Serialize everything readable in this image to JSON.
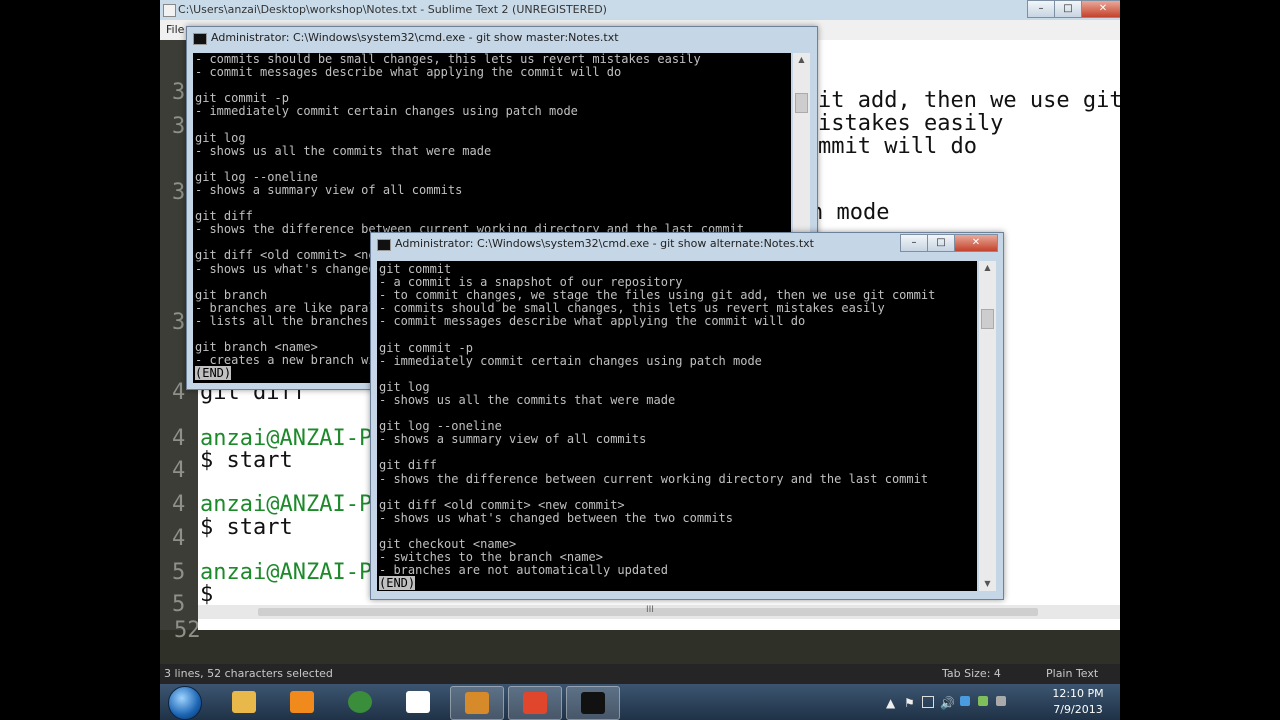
{
  "sublime": {
    "title": "C:\\Users\\anzai\\Desktop\\workshop\\Notes.txt - Sublime Text 2 (UNREGISTERED)",
    "menu_file": "File",
    "line_numbers": [
      "3",
      "3",
      "3",
      "3",
      "4",
      "4",
      "4",
      "4",
      "4",
      "5",
      "5",
      "52"
    ],
    "right_lines": [
      "it add, then we use git",
      "istakes easily",
      "mmit will do",
      "h mode"
    ],
    "left_lines": [
      {
        "text": "git diff",
        "green": false
      },
      {
        "text": "anzai@ANZAI-P",
        "green": true
      },
      {
        "text": "$ start",
        "green": false
      },
      {
        "text": "anzai@ANZAI-P",
        "green": true
      },
      {
        "text": "$ start",
        "green": false
      },
      {
        "text": "anzai@ANZAI-P",
        "green": true
      },
      {
        "text": "$",
        "green": false
      }
    ],
    "status_left": "3 lines, 52 characters selected",
    "status_tab": "Tab Size: 4",
    "status_syntax": "Plain Text",
    "scroll_marker": "III"
  },
  "cmd_back": {
    "title": "Administrator: C:\\Windows\\system32\\cmd.exe - git  show master:Notes.txt",
    "lines": [
      "- commits should be small changes, this lets us revert mistakes easily",
      "- commit messages describe what applying the commit will do",
      "",
      "git commit -p",
      "- immediately commit certain changes using patch mode",
      "",
      "git log",
      "- shows us all the commits that were made",
      "",
      "git log --oneline",
      "- shows a summary view of all commits",
      "",
      "git diff",
      "- shows the difference between current working directory and the last commit",
      "",
      "git diff <old commit> <new commit>",
      "- shows us what's changed between the two commits",
      "",
      "git branch",
      "- branches are like parallel universes",
      "- lists all the branches",
      "",
      "git branch <name>",
      "- creates a new branch with the specified name"
    ],
    "end": "(END)"
  },
  "cmd_front": {
    "title": "Administrator: C:\\Windows\\system32\\cmd.exe - git  show alternate:Notes.txt",
    "lines": [
      "git commit",
      "- a commit is a snapshot of our repository",
      "- to commit changes, we stage the files using git add, then we use git commit",
      "- commits should be small changes, this lets us revert mistakes easily",
      "- commit messages describe what applying the commit will do",
      "",
      "git commit -p",
      "- immediately commit certain changes using patch mode",
      "",
      "git log",
      "- shows us all the commits that were made",
      "",
      "git log --oneline",
      "- shows a summary view of all commits",
      "",
      "git diff",
      "- shows the difference between current working directory and the last commit",
      "",
      "git diff <old commit> <new commit>",
      "- shows us what's changed between the two commits",
      "",
      "git checkout <name>",
      "- switches to the branch <name>",
      "- branches are not automatically updated"
    ],
    "end": "(END)"
  },
  "window_buttons": {
    "minimize": "–",
    "maximize": "□",
    "close": "✕"
  },
  "taskbar": {
    "time": "12:10 PM",
    "date": "7/9/2013",
    "tray_arrow": "▲",
    "tray_flag": "⚑",
    "tray_volume": "🔊",
    "items": [
      {
        "name": "explorer",
        "color": "#e8b84a",
        "active": false
      },
      {
        "name": "media-player",
        "color": "#f08a1c",
        "active": false
      },
      {
        "name": "chrome",
        "color": "#3a8d3a",
        "active": false
      },
      {
        "name": "file",
        "color": "#ffffff",
        "active": false
      },
      {
        "name": "sublime",
        "color": "#d78a2a",
        "active": true
      },
      {
        "name": "git",
        "color": "#e0462b",
        "active": true
      },
      {
        "name": "cmd",
        "color": "#111111",
        "active": true
      }
    ]
  }
}
